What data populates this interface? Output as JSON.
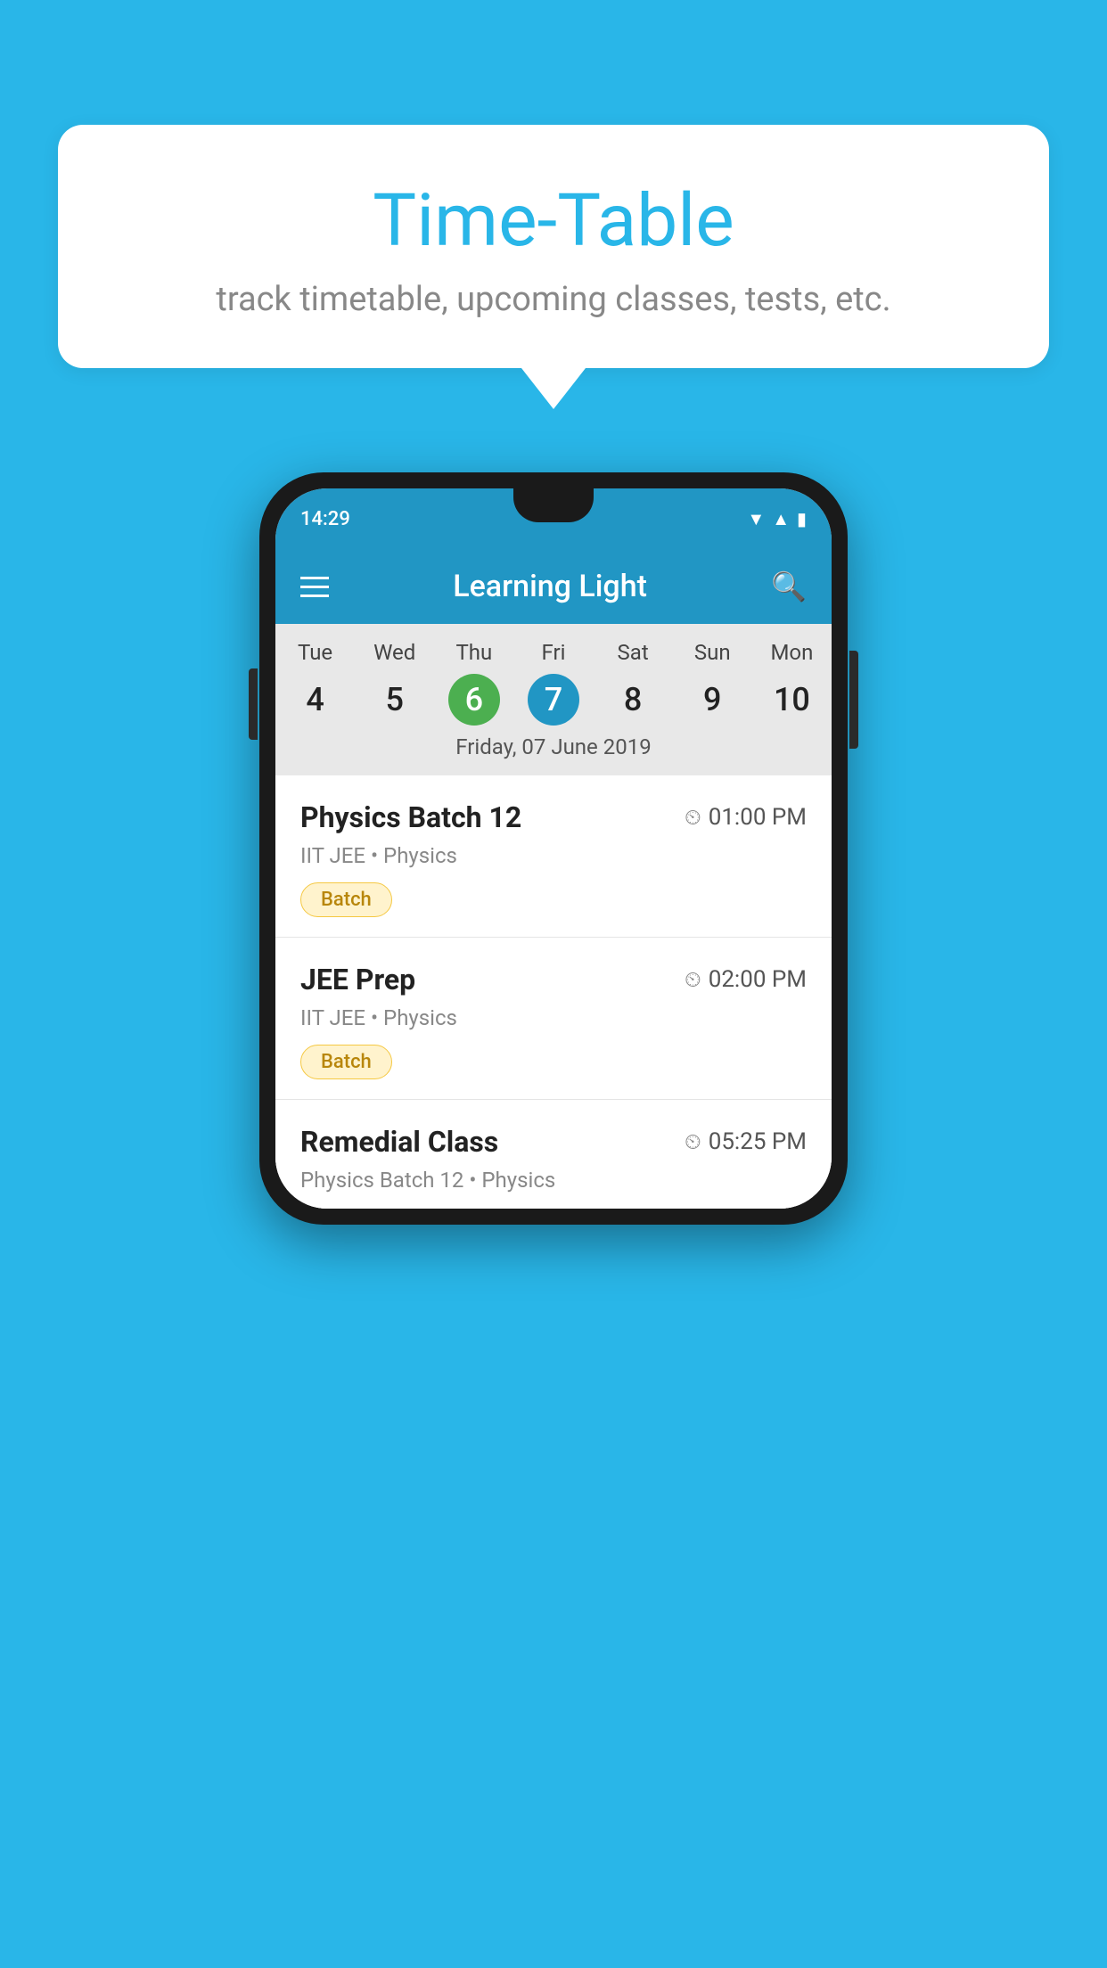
{
  "background_color": "#29b6e8",
  "header": {
    "title": "Time-Table",
    "subtitle": "track timetable, upcoming classes, tests, etc."
  },
  "phone": {
    "status_bar": {
      "time": "14:29"
    },
    "app_bar": {
      "title": "Learning Light"
    },
    "calendar": {
      "days": [
        {
          "label": "Tue",
          "number": "4"
        },
        {
          "label": "Wed",
          "number": "5"
        },
        {
          "label": "Thu",
          "number": "6",
          "state": "today"
        },
        {
          "label": "Fri",
          "number": "7",
          "state": "selected"
        },
        {
          "label": "Sat",
          "number": "8"
        },
        {
          "label": "Sun",
          "number": "9"
        },
        {
          "label": "Mon",
          "number": "10"
        }
      ],
      "selected_date_label": "Friday, 07 June 2019"
    },
    "schedule": [
      {
        "name": "Physics Batch 12",
        "time": "01:00 PM",
        "meta": "IIT JEE • Physics",
        "badge": "Batch"
      },
      {
        "name": "JEE Prep",
        "time": "02:00 PM",
        "meta": "IIT JEE • Physics",
        "badge": "Batch"
      },
      {
        "name": "Remedial Class",
        "time": "05:25 PM",
        "meta": "Physics Batch 12 • Physics",
        "badge": null,
        "partial": true
      }
    ]
  }
}
